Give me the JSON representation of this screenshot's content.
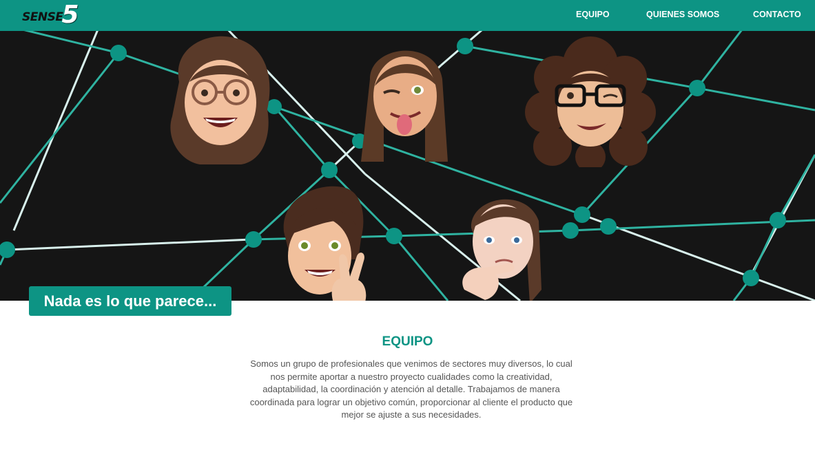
{
  "brand": {
    "logo_text": "SENSE",
    "logo_number": "5"
  },
  "nav": {
    "items": [
      {
        "label": "EQUIPO"
      },
      {
        "label": "QUIENES SOMOS"
      },
      {
        "label": "CONTACTO"
      }
    ]
  },
  "hero": {
    "cta_label": "Nada es lo que parece..."
  },
  "team": {
    "title": "EQUIPO",
    "description": "Somos un grupo de profesionales que venimos de sectores muy diversos, lo cual nos permite aportar a nuestro proyecto cualidades como la creatividad, adaptabilidad, la coordinación y atención al detalle. Trabajamos de manera coordinada para lograr un objetivo común, proporcionar al cliente el producto que mejor se ajuste a sus necesidades."
  },
  "colors": {
    "accent": "#0d9484",
    "hero_bg": "#151515",
    "line_light": "#d8f0ec",
    "line_teal": "#2fb3a1"
  }
}
